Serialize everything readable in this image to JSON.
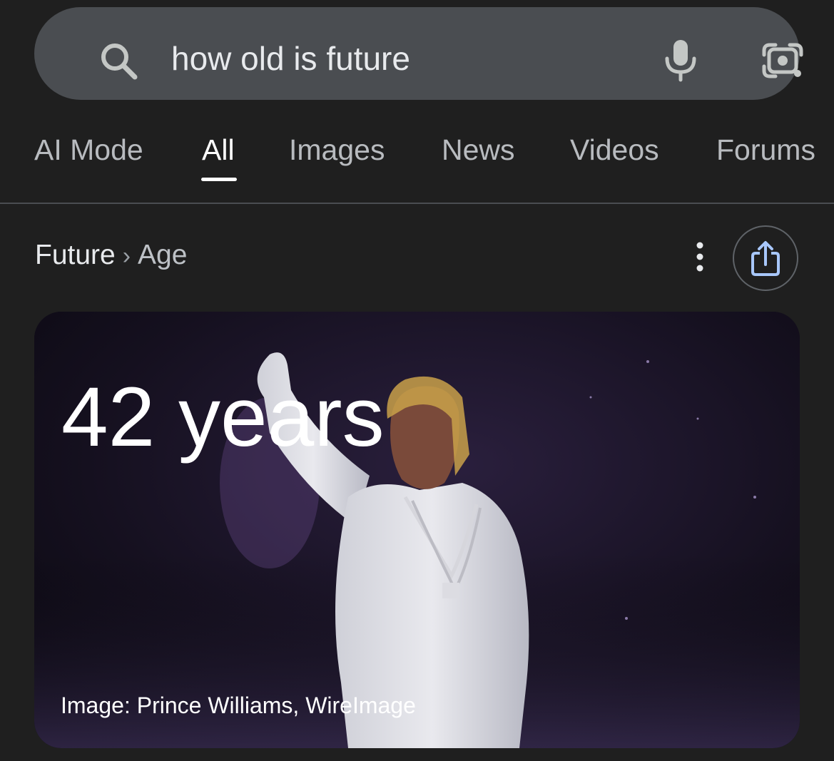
{
  "search": {
    "query": "how old is future",
    "icons": {
      "search": "search-icon",
      "voice": "mic-icon",
      "lens": "camera-lens-icon"
    }
  },
  "tabs": [
    {
      "label": "AI Mode",
      "active": false
    },
    {
      "label": "All",
      "active": true
    },
    {
      "label": "Images",
      "active": false
    },
    {
      "label": "News",
      "active": false
    },
    {
      "label": "Videos",
      "active": false
    },
    {
      "label": "Forums",
      "active": false
    }
  ],
  "breadcrumb": {
    "root": "Future",
    "separator": "›",
    "leaf": "Age"
  },
  "actions": {
    "more_icon": "more-vertical-icon",
    "share_icon": "share-icon"
  },
  "answer_card": {
    "age": "42 years",
    "image_credit": "Image: Prince Williams, WireImage"
  },
  "colors": {
    "page_background": "#1f1f1f",
    "search_bar": "#4a4d51",
    "active_tab": "#ffffff",
    "inactive_tab": "#b8bbbf",
    "share_icon_accent": "#a8c7fa"
  }
}
